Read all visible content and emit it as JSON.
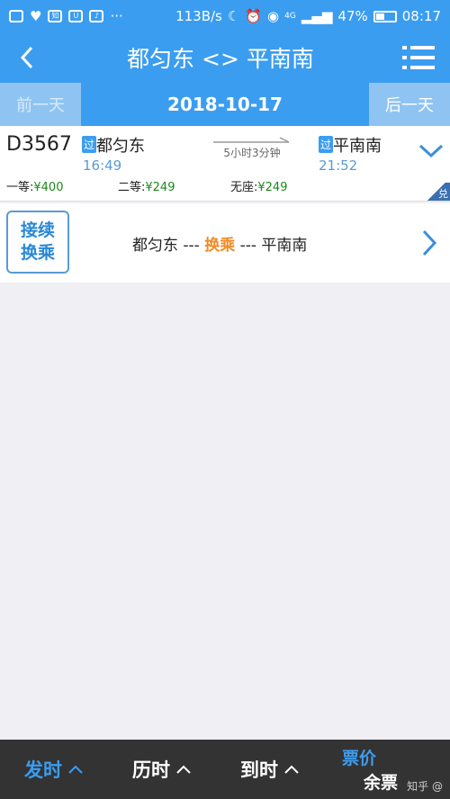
{
  "status_bar": {
    "speed": "113B/s",
    "battery_percent": "47%",
    "battery_level": 0.47,
    "time": "08:17",
    "signal": "4G"
  },
  "header": {
    "back_icon": "chevron-left-icon",
    "title": "都匀东 <> 平南南",
    "menu_icon": "menu-icon"
  },
  "date_bar": {
    "prev_label": "前一天",
    "date": "2018-10-17",
    "next_label": "后一天"
  },
  "train": {
    "number": "D3567",
    "pass_badge": "过",
    "from_station": "都匀东",
    "to_station": "平南南",
    "depart_time": "16:49",
    "arrive_time": "21:52",
    "duration": "5小时3分钟",
    "prices": [
      {
        "label": "一等:",
        "value": "¥400"
      },
      {
        "label": "二等:",
        "value": "¥249"
      },
      {
        "label": "无座:",
        "value": "¥249"
      }
    ],
    "corner_tag": "兑"
  },
  "transfer": {
    "button_line1": "接续",
    "button_line2": "换乘",
    "from": "都匀东 ---",
    "middle": "换乘",
    "to": "--- 平南南"
  },
  "bottom_bar": {
    "depart": "发时",
    "duration": "历时",
    "arrive": "到时",
    "price_top": "票价",
    "price_bottom": "余票",
    "watermark": "知乎 @"
  },
  "colors": {
    "primary": "#3b9df0",
    "accent_orange": "#f08a24",
    "price_green": "#1a8a1a",
    "bottom_bg": "#333333"
  }
}
